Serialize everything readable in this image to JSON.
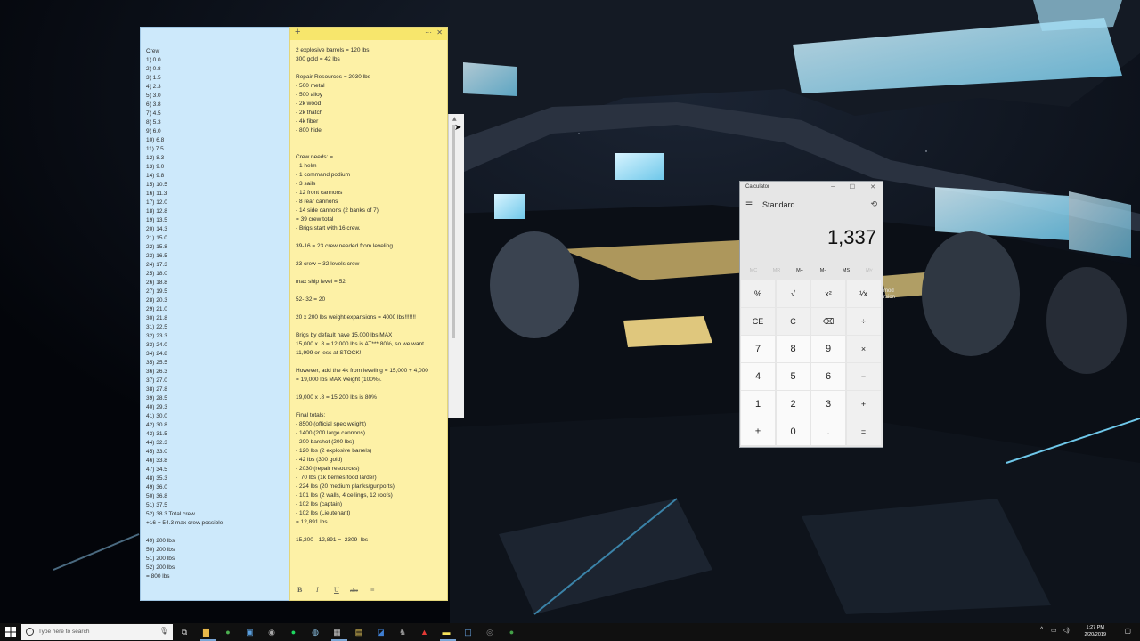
{
  "colors": {
    "note_blue": "#cde9fb",
    "note_yellow": "#fdf1a6",
    "taskbar": "#101010",
    "calculator_bg": "#e6e6e6"
  },
  "blue_note": {
    "lines": [
      "Crew",
      "1) 0.0",
      "2) 0.8",
      "3) 1.5",
      "4) 2.3",
      "5) 3.0",
      "6) 3.8",
      "7) 4.5",
      "8) 5.3",
      "9) 6.0",
      "10) 6.8",
      "11) 7.5",
      "12) 8.3",
      "13) 9.0",
      "14) 9.8",
      "15) 10.5",
      "16) 11.3",
      "17) 12.0",
      "18) 12.8",
      "19) 13.5",
      "20) 14.3",
      "21) 15.0",
      "22) 15.8",
      "23) 16.5",
      "24) 17.3",
      "25) 18.0",
      "26) 18.8",
      "27) 19.5",
      "28) 20.3",
      "29) 21.0",
      "30) 21.8",
      "31) 22.5",
      "32) 23.3",
      "33) 24.0",
      "34) 24.8",
      "35) 25.5",
      "36) 26.3",
      "37) 27.0",
      "38) 27.8",
      "39) 28.5",
      "40) 29.3",
      "41) 30.0",
      "42) 30.8",
      "43) 31.5",
      "44) 32.3",
      "45) 33.0",
      "46) 33.8",
      "47) 34.5",
      "48) 35.3",
      "49) 36.0",
      "50) 36.8",
      "51) 37.5",
      "52) 38.3 Total crew",
      "+16 = 54.3 max crew possible.",
      "",
      "49) 200 lbs",
      "50) 200 lbs",
      "51) 200 lbs",
      "52) 200 lbs",
      "= 800 lbs"
    ]
  },
  "yellow_note": {
    "titlebar": {
      "plus": "+",
      "dots": "···",
      "close": "✕"
    },
    "lines": [
      "2 explosive barrels = 120 lbs",
      "300 gold = 42 lbs",
      "",
      "Repair Resources = 2030 lbs",
      "- 500 metal",
      "- 500 alloy",
      "- 2k wood",
      "- 2k thatch",
      "- 4k fiber",
      "- 800 hide",
      "",
      "",
      "Crew needs: =",
      "- 1 helm",
      "- 1 command podium",
      "- 3 sails",
      "- 12 front cannons",
      "- 8 rear cannons",
      "- 14 side cannons (2 banks of 7)",
      "= 39 crew total",
      "- Brigs start with 16 crew.",
      "",
      "39-16 = 23 crew needed from leveling.",
      "",
      "23 crew = 32 levels crew",
      "",
      "max ship level = 52",
      "",
      "52- 32 = 20",
      "",
      "20 x 200 lbs weight expansions = 4000 lbs!!!!!!!",
      "",
      "Brigs by default have 15,000 lbs MAX",
      "15,000 x .8 = 12,000 lbs is AT*** 80%, so we want",
      "11,999 or less at STOCK!",
      "",
      "However, add the 4k from leveling = 15,000 + 4,000",
      "= 19,000 lbs MAX weight (100%).",
      "",
      "19,000 x .8 = 15,200 lbs is 80%",
      "",
      "Final totals:",
      "- 8500 (official spec weight)",
      "- 1400 (200 large cannons)",
      "- 200 barshot (200 lbs)",
      "- 120 lbs (2 explosive barrels)",
      "- 42 lbs (300 gold)",
      "- 2030 (repair resources)",
      "-  70 lbs (1k berries food larder)",
      "- 224 lbs (20 medium planks/gunports)",
      "- 101 lbs (2 walls, 4 ceilings, 12 roofs)",
      "- 102 lbs (captain)",
      "- 102 lbs (Lieutenant)",
      "= 12,891 lbs",
      "",
      "15,200 - 12,891 =  2309  lbs"
    ],
    "format_bar": {
      "bold": "B",
      "italic": "I",
      "underline": "U",
      "strike": "abc",
      "list": "≡"
    }
  },
  "calculator": {
    "title": "Calculator",
    "mode": "Standard",
    "display": "1,337",
    "window_buttons": {
      "minimize": "–",
      "maximize": "☐",
      "close": "✕"
    },
    "memory": [
      {
        "label": "MC",
        "enabled": false
      },
      {
        "label": "MR",
        "enabled": false
      },
      {
        "label": "M+",
        "enabled": true
      },
      {
        "label": "M-",
        "enabled": true
      },
      {
        "label": "MS",
        "enabled": true
      },
      {
        "label": "M˅",
        "enabled": false
      }
    ],
    "keys": [
      [
        "%",
        "√",
        "x²",
        "¹⁄x"
      ],
      [
        "CE",
        "C",
        "⌫",
        "÷"
      ],
      [
        "7",
        "8",
        "9",
        "×"
      ],
      [
        "4",
        "5",
        "6",
        "−"
      ],
      [
        "1",
        "2",
        "3",
        "+"
      ],
      [
        "±",
        "0",
        ".",
        "="
      ]
    ]
  },
  "desktop": {
    "icon_label_1": "mod",
    "icon_label_2": "rsion"
  },
  "taskbar": {
    "search_placeholder": "Type here to search",
    "icons": [
      "task-view-icon",
      "file-explorer-icon",
      "chrome-icon",
      "photos-icon",
      "steam-icon",
      "spotify-icon",
      "app-icon",
      "calculator-icon",
      "notepad-icon",
      "outlook-icon",
      "game-icon",
      "adobe-icon",
      "sticky-notes-icon",
      "window-icon",
      "obs-icon",
      "chrome-canary-icon"
    ],
    "tray_chevron": "^",
    "time": "1:27 PM",
    "date": "2/20/2019"
  }
}
